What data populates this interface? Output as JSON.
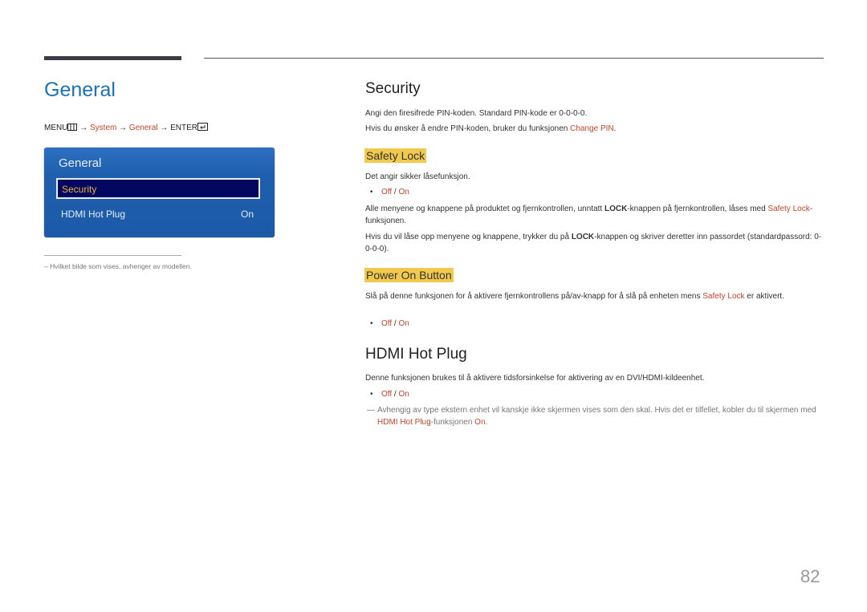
{
  "header": {
    "page_title": "General",
    "path": {
      "menu": "MENU",
      "arrow": "→",
      "system": "System",
      "general": "General",
      "enter": "ENTER"
    }
  },
  "osd": {
    "title": "General",
    "items": [
      {
        "label": "Security",
        "value": "",
        "selected": true
      },
      {
        "label": "HDMI Hot Plug",
        "value": "On",
        "selected": false
      }
    ]
  },
  "footnote": "–  Hvilket bilde som vises, avhenger av modellen.",
  "security": {
    "title": "Security",
    "line1": "Angi den firesifrede PIN-koden. Standard PIN-kode er 0-0-0-0.",
    "line2_pre": "Hvis du ønsker å endre PIN-koden, bruker du funksjonen ",
    "line2_link": "Change PIN",
    "line2_post": "."
  },
  "safety_lock": {
    "title": "Safety Lock",
    "desc": "Det angir sikker låsefunksjon.",
    "options": {
      "off": "Off",
      "sep": " / ",
      "on": "On"
    },
    "p1_a": "Alle menyene og knappene på produktet og fjernkontrollen, unntatt ",
    "p1_lock": "LOCK",
    "p1_b": "-knappen på fjernkontrollen, låses med ",
    "p1_link": "Safety Lock",
    "p1_c": "-funksjonen.",
    "p2_a": "Hvis du vil låse opp menyene og knappene, trykker du på ",
    "p2_lock": "LOCK",
    "p2_b": "-knappen og skriver deretter inn passordet (standardpassord: 0-0-0-0)."
  },
  "power_on_button": {
    "title": "Power On Button",
    "p_a": "Slå på denne funksjonen for å aktivere fjernkontrollens på/av-knapp for å slå på enheten mens ",
    "p_link": "Safety Lock",
    "p_b": " er aktivert.",
    "options": {
      "off": "Off",
      "sep": " / ",
      "on": "On"
    }
  },
  "hdmi_hot_plug": {
    "title": "HDMI Hot Plug",
    "desc": "Denne funksjonen brukes til å aktivere tidsforsinkelse for aktivering av en DVI/HDMI-kildeenhet.",
    "options": {
      "off": "Off",
      "sep": " / ",
      "on": "On"
    },
    "note_a": "Avhengig av type ekstern enhet vil kanskje ikke skjermen vises som den skal. Hvis det er tilfellet, kobler du til skjermen med ",
    "note_link": "HDMI Hot Plug",
    "note_b": "-funksjonen ",
    "note_on": "On",
    "note_c": "."
  },
  "page_number": "82"
}
